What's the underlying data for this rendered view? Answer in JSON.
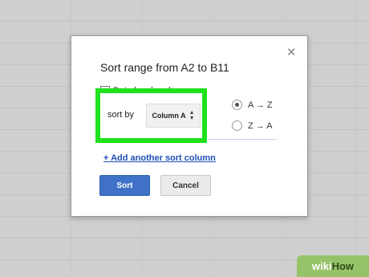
{
  "dialog": {
    "title": "Sort range from A2 to B11",
    "close_glyph": "✕",
    "header_row_label": "Data has header row",
    "sort_by_label": "sort by",
    "column_select_value": "Column A",
    "radio_options": [
      {
        "label": "A → Z",
        "checked": true
      },
      {
        "label": "Z → A",
        "checked": false
      }
    ],
    "add_sort_column_link": "+ Add another sort column",
    "sort_button": "Sort",
    "cancel_button": "Cancel"
  },
  "highlight_color": "#1ee21e",
  "accent_color": "#3f72c7",
  "watermark": {
    "part1": "wiki",
    "part2": "How"
  }
}
